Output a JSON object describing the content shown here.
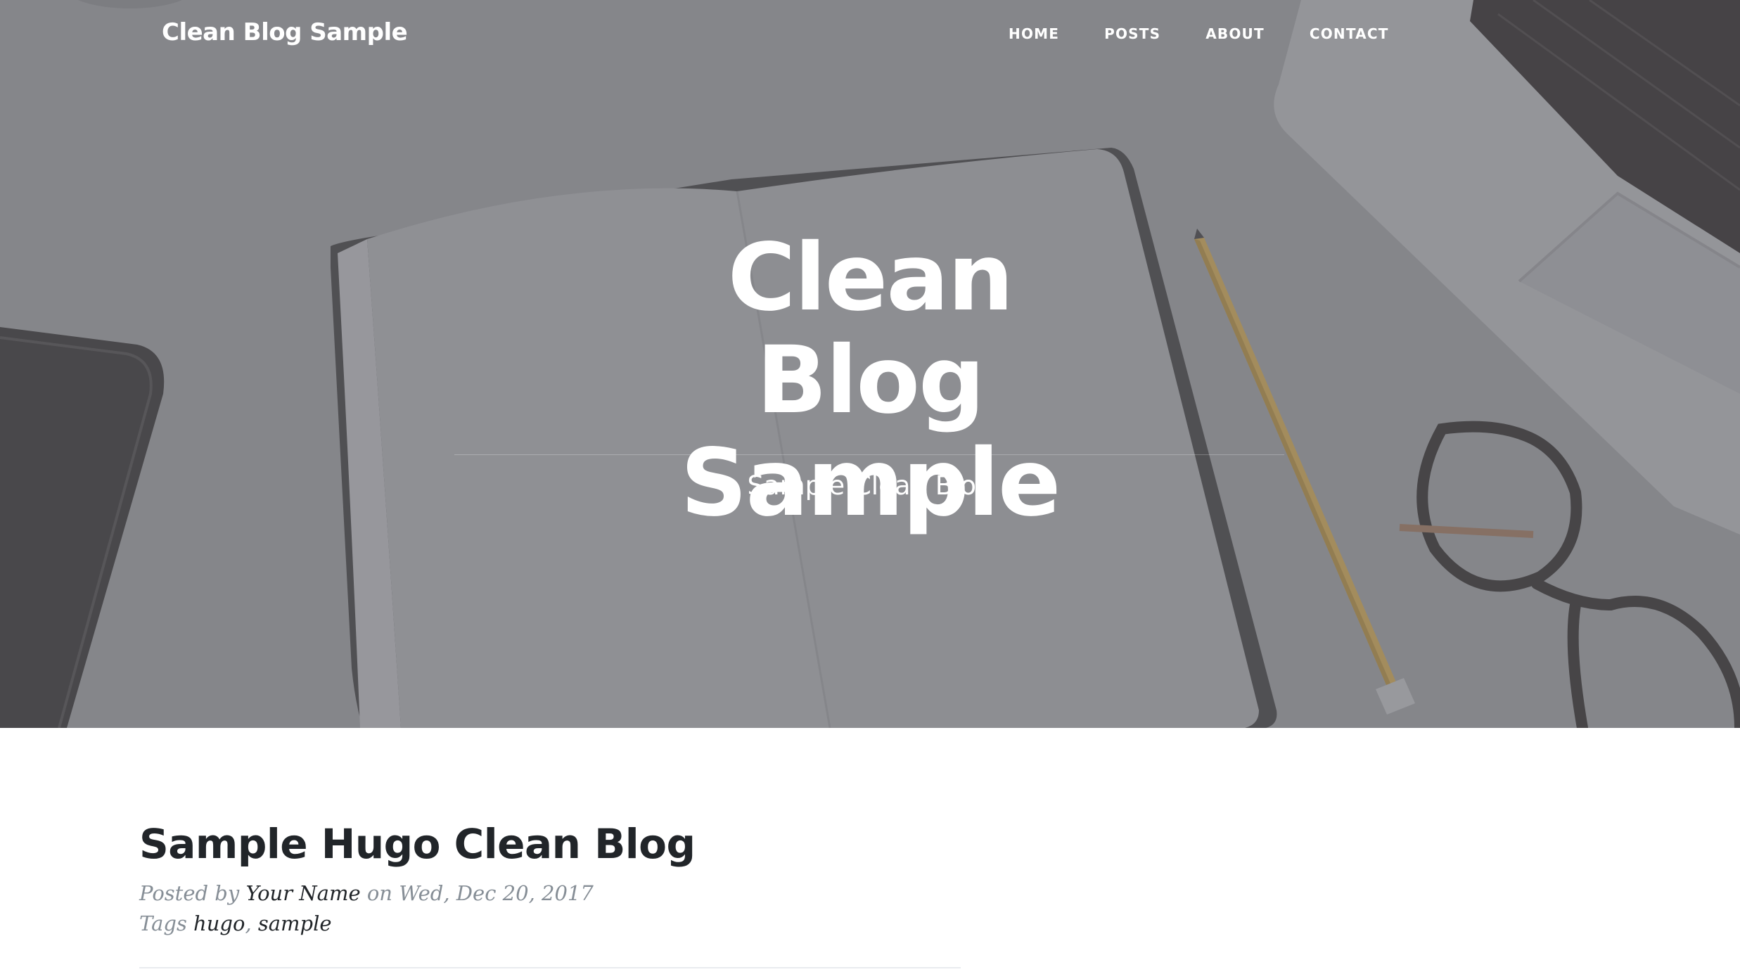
{
  "navbar": {
    "brand": "Clean Blog Sample",
    "links": [
      {
        "label": "HOME"
      },
      {
        "label": "POSTS"
      },
      {
        "label": "ABOUT"
      },
      {
        "label": "CONTACT"
      }
    ]
  },
  "hero": {
    "title": "Clean Blog Sample",
    "subtitle": "Sample Clean Blog"
  },
  "posts": [
    {
      "title": "Sample Hugo Clean Blog",
      "posted_by_prefix": "Posted by",
      "author": "Your Name",
      "date_prefix": "on",
      "date": "Wed, Dec 20, 2017",
      "tags_prefix": "Tags",
      "tags": [
        "hugo",
        "sample"
      ],
      "tag_separator": ","
    }
  ],
  "colors": {
    "hero_overlay": "#8a8b8f",
    "heading_text": "#212529",
    "meta_text": "#868e96",
    "divider": "#e9ecef"
  }
}
